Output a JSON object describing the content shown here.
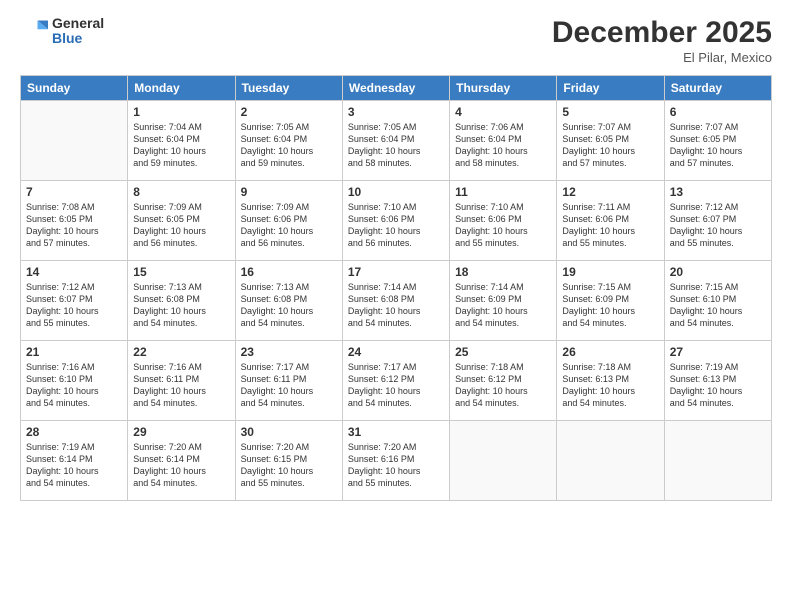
{
  "header": {
    "logo_general": "General",
    "logo_blue": "Blue",
    "month": "December 2025",
    "location": "El Pilar, Mexico"
  },
  "weekdays": [
    "Sunday",
    "Monday",
    "Tuesday",
    "Wednesday",
    "Thursday",
    "Friday",
    "Saturday"
  ],
  "weeks": [
    [
      {
        "day": "",
        "info": ""
      },
      {
        "day": "1",
        "info": "Sunrise: 7:04 AM\nSunset: 6:04 PM\nDaylight: 10 hours\nand 59 minutes."
      },
      {
        "day": "2",
        "info": "Sunrise: 7:05 AM\nSunset: 6:04 PM\nDaylight: 10 hours\nand 59 minutes."
      },
      {
        "day": "3",
        "info": "Sunrise: 7:05 AM\nSunset: 6:04 PM\nDaylight: 10 hours\nand 58 minutes."
      },
      {
        "day": "4",
        "info": "Sunrise: 7:06 AM\nSunset: 6:04 PM\nDaylight: 10 hours\nand 58 minutes."
      },
      {
        "day": "5",
        "info": "Sunrise: 7:07 AM\nSunset: 6:05 PM\nDaylight: 10 hours\nand 57 minutes."
      },
      {
        "day": "6",
        "info": "Sunrise: 7:07 AM\nSunset: 6:05 PM\nDaylight: 10 hours\nand 57 minutes."
      }
    ],
    [
      {
        "day": "7",
        "info": "Sunrise: 7:08 AM\nSunset: 6:05 PM\nDaylight: 10 hours\nand 57 minutes."
      },
      {
        "day": "8",
        "info": "Sunrise: 7:09 AM\nSunset: 6:05 PM\nDaylight: 10 hours\nand 56 minutes."
      },
      {
        "day": "9",
        "info": "Sunrise: 7:09 AM\nSunset: 6:06 PM\nDaylight: 10 hours\nand 56 minutes."
      },
      {
        "day": "10",
        "info": "Sunrise: 7:10 AM\nSunset: 6:06 PM\nDaylight: 10 hours\nand 56 minutes."
      },
      {
        "day": "11",
        "info": "Sunrise: 7:10 AM\nSunset: 6:06 PM\nDaylight: 10 hours\nand 55 minutes."
      },
      {
        "day": "12",
        "info": "Sunrise: 7:11 AM\nSunset: 6:06 PM\nDaylight: 10 hours\nand 55 minutes."
      },
      {
        "day": "13",
        "info": "Sunrise: 7:12 AM\nSunset: 6:07 PM\nDaylight: 10 hours\nand 55 minutes."
      }
    ],
    [
      {
        "day": "14",
        "info": "Sunrise: 7:12 AM\nSunset: 6:07 PM\nDaylight: 10 hours\nand 55 minutes."
      },
      {
        "day": "15",
        "info": "Sunrise: 7:13 AM\nSunset: 6:08 PM\nDaylight: 10 hours\nand 54 minutes."
      },
      {
        "day": "16",
        "info": "Sunrise: 7:13 AM\nSunset: 6:08 PM\nDaylight: 10 hours\nand 54 minutes."
      },
      {
        "day": "17",
        "info": "Sunrise: 7:14 AM\nSunset: 6:08 PM\nDaylight: 10 hours\nand 54 minutes."
      },
      {
        "day": "18",
        "info": "Sunrise: 7:14 AM\nSunset: 6:09 PM\nDaylight: 10 hours\nand 54 minutes."
      },
      {
        "day": "19",
        "info": "Sunrise: 7:15 AM\nSunset: 6:09 PM\nDaylight: 10 hours\nand 54 minutes."
      },
      {
        "day": "20",
        "info": "Sunrise: 7:15 AM\nSunset: 6:10 PM\nDaylight: 10 hours\nand 54 minutes."
      }
    ],
    [
      {
        "day": "21",
        "info": "Sunrise: 7:16 AM\nSunset: 6:10 PM\nDaylight: 10 hours\nand 54 minutes."
      },
      {
        "day": "22",
        "info": "Sunrise: 7:16 AM\nSunset: 6:11 PM\nDaylight: 10 hours\nand 54 minutes."
      },
      {
        "day": "23",
        "info": "Sunrise: 7:17 AM\nSunset: 6:11 PM\nDaylight: 10 hours\nand 54 minutes."
      },
      {
        "day": "24",
        "info": "Sunrise: 7:17 AM\nSunset: 6:12 PM\nDaylight: 10 hours\nand 54 minutes."
      },
      {
        "day": "25",
        "info": "Sunrise: 7:18 AM\nSunset: 6:12 PM\nDaylight: 10 hours\nand 54 minutes."
      },
      {
        "day": "26",
        "info": "Sunrise: 7:18 AM\nSunset: 6:13 PM\nDaylight: 10 hours\nand 54 minutes."
      },
      {
        "day": "27",
        "info": "Sunrise: 7:19 AM\nSunset: 6:13 PM\nDaylight: 10 hours\nand 54 minutes."
      }
    ],
    [
      {
        "day": "28",
        "info": "Sunrise: 7:19 AM\nSunset: 6:14 PM\nDaylight: 10 hours\nand 54 minutes."
      },
      {
        "day": "29",
        "info": "Sunrise: 7:20 AM\nSunset: 6:14 PM\nDaylight: 10 hours\nand 54 minutes."
      },
      {
        "day": "30",
        "info": "Sunrise: 7:20 AM\nSunset: 6:15 PM\nDaylight: 10 hours\nand 55 minutes."
      },
      {
        "day": "31",
        "info": "Sunrise: 7:20 AM\nSunset: 6:16 PM\nDaylight: 10 hours\nand 55 minutes."
      },
      {
        "day": "",
        "info": ""
      },
      {
        "day": "",
        "info": ""
      },
      {
        "day": "",
        "info": ""
      }
    ]
  ]
}
